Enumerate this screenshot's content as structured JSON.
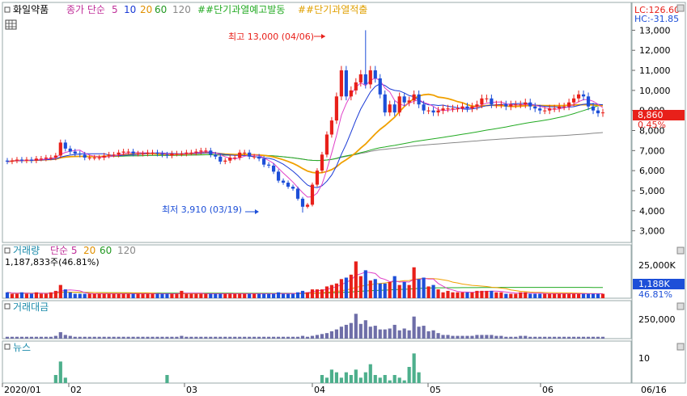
{
  "header": {
    "stock_name": "화일약품",
    "ma_label": "종가 단순",
    "ma_periods": [
      "5",
      "10",
      "20",
      "60",
      "120"
    ],
    "signal_a": "##단기과열예고발동",
    "signal_b": "##단기과열적출",
    "lc_label": "LC:126.60",
    "hc_label": "HC:-31.85"
  },
  "price_panel": {
    "y_ticks": [
      "13,000",
      "12,000",
      "11,000",
      "10,000",
      "9,000",
      "8,000",
      "7,000",
      "6,000",
      "5,000",
      "4,000",
      "3,000"
    ],
    "current_price": "8,860",
    "change_pct": "0.45%",
    "high_annotation": "최고 13,000 (04/06)",
    "low_annotation": "최저 3,910 (03/19)"
  },
  "volume_panel": {
    "title": "거래량",
    "ma_label": "단순 5",
    "ma_periods": [
      "20",
      "60",
      "120"
    ],
    "info": "1,187,833주(46.81%)",
    "y_tick": "25,000K",
    "current_value": "1,188K",
    "current_pct": "46.81%"
  },
  "amount_panel": {
    "title": "거래대금",
    "y_tick": "250,000"
  },
  "news_panel": {
    "title": "뉴스",
    "y_tick": "10"
  },
  "x_axis": {
    "labels": [
      "2020/01",
      "02",
      "03",
      "04",
      "05",
      "06"
    ],
    "end_label": "06/16"
  },
  "colors": {
    "up": "#e8201a",
    "down": "#1d4fd8",
    "ma5": "#e040c8",
    "ma10": "#1a3ad6",
    "ma20": "#f0a000",
    "ma60": "#22aa22",
    "ma120": "#888888",
    "amount_bar": "#6e6ea8",
    "news_bar": "#4daf8c"
  },
  "chart_data": {
    "type": "candlestick",
    "x_range": [
      "2020/01",
      "06/16"
    ],
    "price_ylim": [
      2500,
      13500
    ],
    "open": [
      6500,
      6450,
      6500,
      6550,
      6500,
      6550,
      6500,
      6600,
      6600,
      6650,
      6650,
      6750,
      7400,
      7100,
      6950,
      6850,
      6800,
      6650,
      6650,
      6650,
      6650,
      6750,
      6800,
      6800,
      6900,
      6950,
      6950,
      6850,
      6850,
      6850,
      6900,
      6900,
      6850,
      6800,
      6750,
      6850,
      6850,
      6850,
      6900,
      6900,
      6950,
      7000,
      7000,
      6800,
      6700,
      6450,
      6500,
      6650,
      6650,
      6900,
      6900,
      6700,
      6700,
      6600,
      6300,
      6250,
      5950,
      5500,
      5400,
      5200,
      5100,
      4600,
      4200,
      4300,
      5300,
      6000,
      6800,
      7800,
      8500,
      9700,
      11000,
      9700,
      10000,
      10400,
      10800,
      10300,
      11000,
      10600,
      9800,
      8900,
      9300,
      8900,
      9700,
      9400,
      9500,
      9800,
      9300,
      9000,
      9000,
      8900,
      9000,
      9100,
      9100,
      9100,
      9100,
      9200,
      9100,
      9200,
      9300,
      9600,
      9600,
      9300,
      9300,
      9300,
      9200,
      9300,
      9300,
      9300,
      9400,
      9200,
      9100,
      9000,
      9000,
      9100,
      9100,
      9200,
      9200,
      9400,
      9600,
      9800,
      9700,
      9200,
      9000,
      8860
    ],
    "close": [
      6450,
      6500,
      6550,
      6500,
      6550,
      6500,
      6600,
      6600,
      6650,
      6650,
      6750,
      7400,
      7100,
      6950,
      6850,
      6800,
      6650,
      6650,
      6650,
      6650,
      6750,
      6800,
      6800,
      6900,
      6950,
      6950,
      6850,
      6850,
      6850,
      6900,
      6900,
      6850,
      6800,
      6750,
      6850,
      6850,
      6850,
      6900,
      6900,
      6950,
      7000,
      7000,
      6800,
      6700,
      6450,
      6500,
      6650,
      6650,
      6900,
      6900,
      6700,
      6700,
      6600,
      6300,
      6250,
      5950,
      5500,
      5400,
      5200,
      5100,
      4600,
      4200,
      4300,
      5300,
      6000,
      6800,
      7800,
      8500,
      9700,
      11000,
      9700,
      10000,
      10400,
      10800,
      10300,
      11000,
      10600,
      9800,
      8900,
      9300,
      8900,
      9700,
      9400,
      9500,
      9800,
      9300,
      9000,
      9000,
      8900,
      9000,
      9100,
      9100,
      9100,
      9100,
      9200,
      9100,
      9200,
      9300,
      9600,
      9600,
      9300,
      9300,
      9300,
      9200,
      9300,
      9300,
      9300,
      9400,
      9200,
      9100,
      9000,
      9000,
      9100,
      9100,
      9200,
      9200,
      9400,
      9600,
      9800,
      9700,
      9200,
      9000,
      8860,
      8900
    ],
    "high_max": 13000,
    "low_min": 3910,
    "volume": [
      4,
      3,
      3,
      4,
      3,
      3,
      4,
      3,
      3,
      4,
      5,
      9,
      6,
      4,
      3,
      3,
      3,
      3,
      3,
      3,
      3,
      3,
      3,
      3,
      3,
      3,
      3,
      3,
      3,
      3,
      3,
      3,
      3,
      3,
      3,
      3,
      5,
      3,
      3,
      3,
      3,
      3,
      3,
      3,
      3,
      3,
      3,
      3,
      3,
      3,
      3,
      3,
      3,
      3,
      3,
      3,
      4,
      3,
      3,
      3,
      4,
      5,
      4,
      6,
      6,
      6,
      8,
      9,
      10,
      13,
      14,
      16,
      25,
      15,
      19,
      12,
      13,
      10,
      10,
      11,
      15,
      9,
      11,
      9,
      21,
      13,
      14,
      8,
      9,
      6,
      4,
      5,
      4,
      4,
      4,
      4,
      4,
      5,
      5,
      5,
      5,
      4,
      4,
      3,
      3,
      3,
      4,
      4,
      3,
      3,
      3,
      3,
      3,
      3,
      3,
      3,
      3,
      3,
      3,
      3,
      3,
      3,
      3,
      3
    ],
    "amount": [
      2,
      2,
      2,
      2,
      2,
      2,
      2,
      2,
      2,
      2,
      3,
      7,
      4,
      3,
      2,
      2,
      2,
      2,
      2,
      2,
      2,
      2,
      2,
      2,
      2,
      2,
      2,
      2,
      2,
      2,
      2,
      2,
      2,
      2,
      2,
      2,
      3,
      2,
      2,
      2,
      2,
      2,
      2,
      2,
      2,
      2,
      2,
      2,
      2,
      2,
      2,
      2,
      2,
      2,
      2,
      2,
      2,
      2,
      2,
      2,
      2,
      3,
      2,
      3,
      4,
      5,
      6,
      8,
      10,
      13,
      15,
      17,
      27,
      16,
      20,
      13,
      14,
      10,
      10,
      11,
      15,
      9,
      11,
      9,
      24,
      13,
      14,
      8,
      9,
      6,
      4,
      4,
      3,
      3,
      3,
      3,
      3,
      4,
      4,
      4,
      4,
      3,
      3,
      2,
      2,
      2,
      3,
      3,
      2,
      2,
      2,
      2,
      2,
      2,
      2,
      2,
      2,
      2,
      2,
      2,
      2,
      2,
      2,
      2
    ],
    "news": [
      0,
      0,
      0,
      0,
      0,
      0,
      0,
      0,
      0,
      0,
      3,
      8,
      2,
      0,
      0,
      0,
      0,
      0,
      0,
      0,
      0,
      0,
      0,
      0,
      0,
      0,
      0,
      0,
      0,
      0,
      0,
      0,
      0,
      3,
      0,
      0,
      0,
      0,
      0,
      0,
      0,
      0,
      0,
      0,
      0,
      0,
      0,
      0,
      0,
      0,
      0,
      0,
      0,
      0,
      0,
      0,
      0,
      0,
      0,
      0,
      0,
      0,
      0,
      0,
      0,
      3,
      2,
      5,
      4,
      2,
      4,
      3,
      5,
      2,
      4,
      7,
      3,
      2,
      3,
      1,
      3,
      2,
      1,
      6,
      11,
      4,
      0,
      0,
      0,
      0,
      0,
      0,
      0,
      0,
      0,
      0,
      0,
      0,
      0,
      0,
      0,
      0,
      0,
      0,
      0,
      0,
      0,
      0,
      0,
      0,
      0,
      0,
      0,
      0,
      0,
      0,
      0,
      0,
      0,
      0,
      0,
      0,
      0,
      0
    ]
  }
}
